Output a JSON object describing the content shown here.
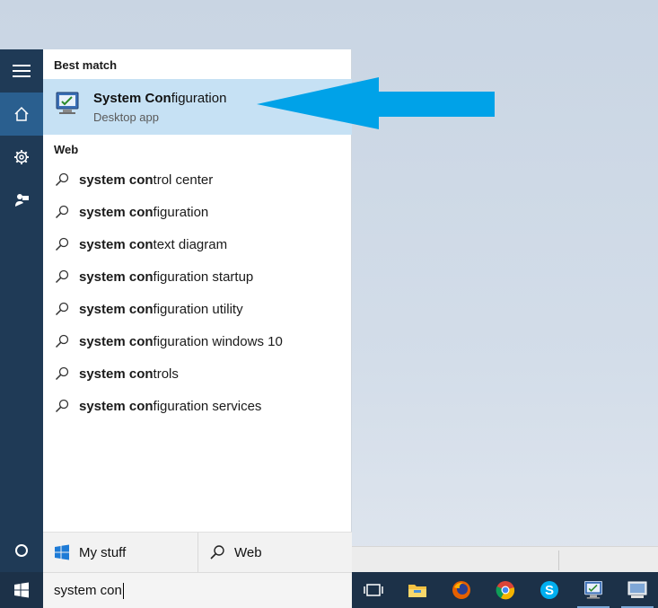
{
  "start_menu": {
    "best_match_label": "Best match",
    "best_match": {
      "title_bold": "System Con",
      "title_rest": "figuration",
      "subtitle": "Desktop app",
      "icon": "system-configuration-icon"
    },
    "web_label": "Web",
    "web_results": [
      {
        "bold": "system con",
        "rest": "trol center"
      },
      {
        "bold": "system con",
        "rest": "figuration"
      },
      {
        "bold": "system con",
        "rest": "text diagram"
      },
      {
        "bold": "system con",
        "rest": "figuration startup"
      },
      {
        "bold": "system con",
        "rest": "figuration utility"
      },
      {
        "bold": "system con",
        "rest": "figuration windows 10"
      },
      {
        "bold": "system con",
        "rest": "trols"
      },
      {
        "bold": "system con",
        "rest": "figuration services"
      }
    ],
    "bottom": {
      "my_stuff_label": "My stuff",
      "web_label": "Web"
    }
  },
  "rail": {
    "icons": [
      "hamburger-icon",
      "home-icon",
      "settings-icon",
      "feedback-icon",
      "cortana-icon"
    ]
  },
  "taskbar": {
    "search_value": "system con",
    "icons": [
      "windows-start-icon",
      "task-view-icon",
      "file-explorer-icon",
      "firefox-icon",
      "chrome-icon",
      "skype-icon",
      "system-configuration-icon",
      "remote-desktop-icon"
    ]
  },
  "colors": {
    "accent": "#2a5f8f",
    "rail": "#1f3a56",
    "taskbar": "#1c3148",
    "selection": "#c6e1f4",
    "arrow": "#00a2e8"
  }
}
